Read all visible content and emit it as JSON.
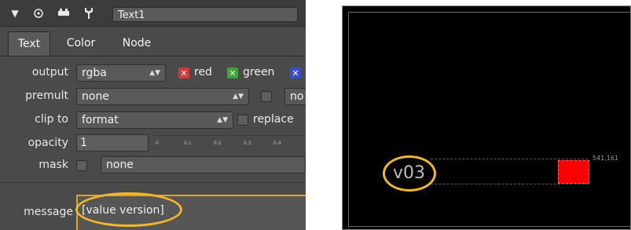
{
  "panel": {
    "node_name": "Text1",
    "tabs": [
      {
        "label": "Text",
        "active": true
      },
      {
        "label": "Color",
        "active": false
      },
      {
        "label": "Node",
        "active": false
      }
    ],
    "output": {
      "label": "output",
      "value": "rgba",
      "channels": [
        {
          "label": "red",
          "color": "#d23a3a",
          "checked": true
        },
        {
          "label": "green",
          "color": "#3aa63a",
          "checked": true
        },
        {
          "label": "",
          "color": "#3a4ad2",
          "checked": true
        }
      ]
    },
    "premult": {
      "label": "premult",
      "value": "none",
      "extra": "no"
    },
    "clip_to": {
      "label": "clip to",
      "value": "format",
      "checkbox_label": "replace"
    },
    "opacity": {
      "label": "opacity",
      "value": "1",
      "ticks": [
        "0",
        "0.1",
        "0.2",
        "0.3",
        "0.4"
      ]
    },
    "mask": {
      "label": "mask",
      "value": "none"
    },
    "message": {
      "label": "message",
      "value": "[value version]"
    }
  },
  "viewer": {
    "overlay_text": "v03",
    "coordinate": "541,161",
    "box_color": "#ff0000"
  },
  "highlight_color": "#f0b72d"
}
